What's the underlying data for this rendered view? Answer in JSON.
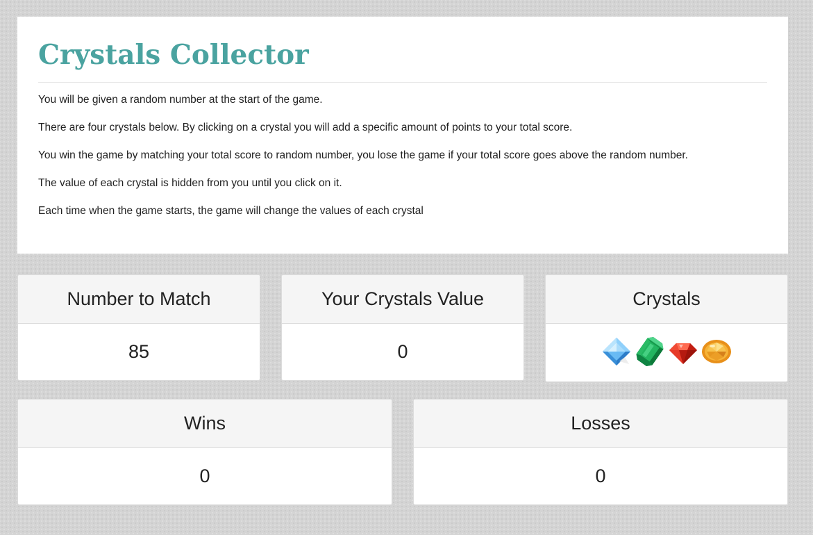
{
  "header": {
    "title": "Crystals Collector"
  },
  "instructions": [
    "You will be given a random number at the start of the game.",
    "There are four crystals below. By clicking on a crystal you will add a specific amount of points to your total score.",
    "You win the game by matching your total score to random number, you lose the game if your total score goes above the random number.",
    "The value of each crystal is hidden from you until you click on it.",
    "Each time when the game starts, the game will change the values of each crystal"
  ],
  "panels": {
    "number_to_match": {
      "label": "Number to Match",
      "value": "85"
    },
    "crystals_value": {
      "label": "Your Crystals Value",
      "value": "0"
    },
    "crystals": {
      "label": "Crystals",
      "items": [
        {
          "icon": "blue-diamond-icon",
          "color": "#5ab4f0"
        },
        {
          "icon": "green-emerald-icon",
          "color": "#1fae5a"
        },
        {
          "icon": "red-ruby-icon",
          "color": "#e12a1e"
        },
        {
          "icon": "yellow-topaz-icon",
          "color": "#f0a21e"
        }
      ]
    },
    "wins": {
      "label": "Wins",
      "value": "0"
    },
    "losses": {
      "label": "Losses",
      "value": "0"
    }
  },
  "colors": {
    "title": "#4aa3a0",
    "background": "#d4d4d4"
  }
}
